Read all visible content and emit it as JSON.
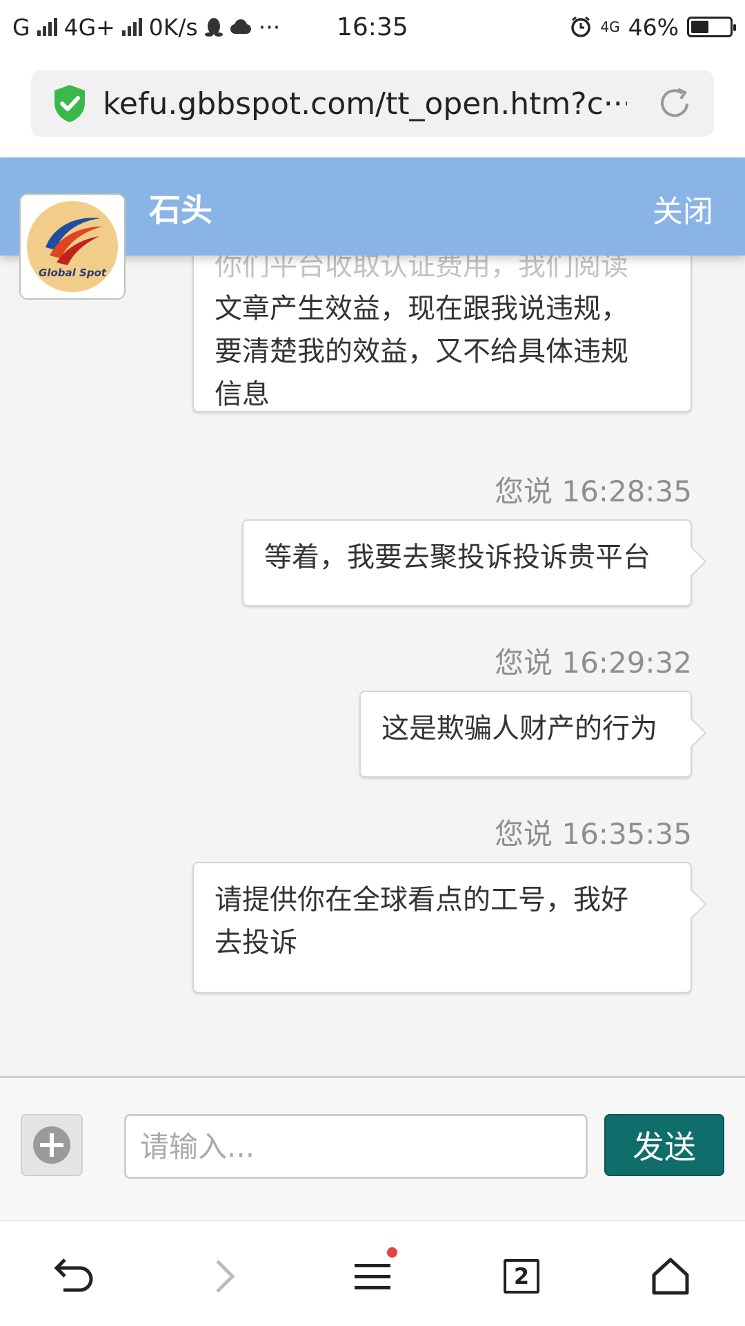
{
  "status_bar": {
    "carrier1": "G",
    "carrier2": "4G+",
    "net_speed": "0K/s",
    "more": "···",
    "time": "16:35",
    "network2": "4G",
    "battery_pct": "46%",
    "battery_level": 0.46
  },
  "browser": {
    "url": "kefu.gbbspot.com/tt_open.htm?c···"
  },
  "header": {
    "agent_name": "石头",
    "close_label": "关闭",
    "logo_text": "Global Spot"
  },
  "messages": [
    {
      "lines": [
        "你们平台收取认证费用，我们阅读",
        "文章产生效益，现在跟我说违规，",
        "要清楚我的效益，又不给具体违规",
        "信息"
      ]
    },
    {
      "stamp": "您说 16:28:35",
      "lines": [
        "等着，我要去聚投诉投诉贵平台"
      ]
    },
    {
      "stamp": "您说 16:29:32",
      "lines": [
        "这是欺骗人财产的行为"
      ]
    },
    {
      "stamp": "您说 16:35:35",
      "lines": [
        "请提供你在全球看点的工号，我好",
        "去投诉"
      ]
    }
  ],
  "input": {
    "placeholder": "请输入...",
    "send_label": "发送"
  },
  "bottom_nav": {
    "tab_count": "2"
  },
  "colors": {
    "header_bg": "#8ab4e6",
    "send_bg": "#0f6d6b",
    "badge_dot": "#e8423c"
  }
}
